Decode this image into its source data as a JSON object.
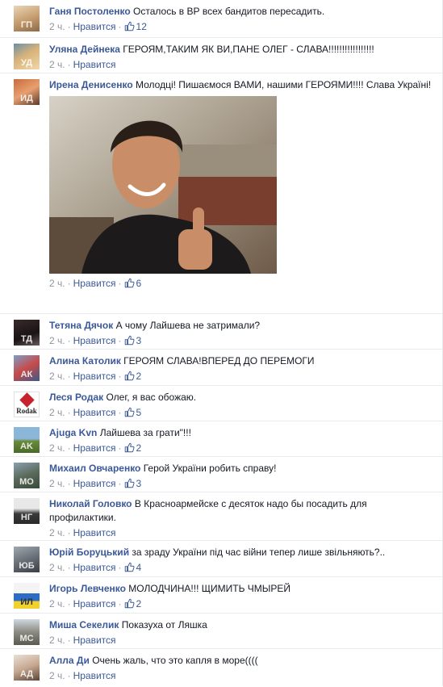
{
  "like_label": "Нравится",
  "comments": [
    {
      "author": "Ганя Постоленко",
      "text": "Осталось в ВР всех бандитов пересадить.",
      "time": "2 ч.",
      "likes": "12"
    },
    {
      "author": "Уляна Дейнека",
      "text": "ГЕРОЯМ,ТАКИМ ЯК ВИ,ПАНЕ ОЛЕГ - СЛАВА!!!!!!!!!!!!!!!!!",
      "time": "2 ч."
    },
    {
      "author": "Ирена Денисенко",
      "text": "Молодці! Пишаємося ВАМИ, нашими ГЕРОЯМИ!!!! Слава Україні!",
      "time": "2 ч.",
      "likes": "6"
    },
    {
      "author": "Тетяна Дячок",
      "text": "А чому Лайшева не затримали?",
      "time": "2 ч.",
      "likes": "3"
    },
    {
      "author": "Алина Католик",
      "text": "ГЕРОЯМ СЛАВА!ВПЕРЕД ДО ПЕРЕМОГИ",
      "time": "2 ч.",
      "likes": "2"
    },
    {
      "author": "Леся Родак",
      "text": "Олег, я вас обожаю.",
      "time": "2 ч.",
      "likes": "5",
      "avatar_logo": "Rodak"
    },
    {
      "author": "Ajuga Kvn",
      "text": "Лайшева за грати\"!!!",
      "time": "2 ч.",
      "likes": "2"
    },
    {
      "author": "Михаил Овчаренко",
      "text": "Герой України робить справу!",
      "time": "2 ч.",
      "likes": "3"
    },
    {
      "author": "Николай Головко",
      "text": "В Красноармейске с десяток надо бы посадить для профилактики.",
      "time": "2 ч."
    },
    {
      "author": "Юрій Боруцький",
      "text": "за зраду України під час війни тепер лише звільняють?..",
      "time": "2 ч.",
      "likes": "4"
    },
    {
      "author": "Игорь Левченко",
      "text": "МОЛОДЧИНА!!! ЩИМИТЬ ЧМЫРЕЙ",
      "time": "2 ч.",
      "likes": "2"
    },
    {
      "author": "Миша Секелик",
      "text": "Показуха от Ляшка",
      "time": "2 ч."
    },
    {
      "author": "Алла Ди",
      "text": "Очень жаль, что это капля в море((((",
      "time": "2 ч."
    }
  ],
  "colors": {
    "author": "#3b5998",
    "meta": "#90949c",
    "divider": "#e9eaed"
  },
  "icons": {
    "like_count": "thumbs-up-outline-icon"
  }
}
